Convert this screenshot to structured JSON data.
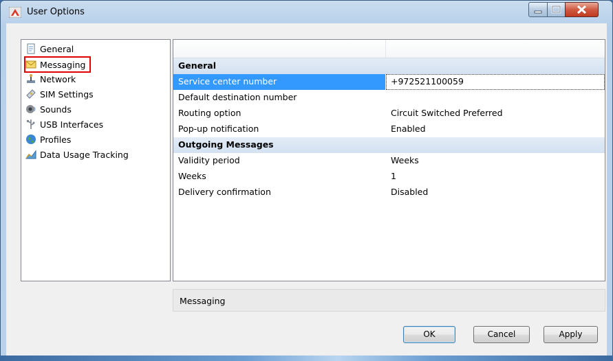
{
  "window": {
    "title": "User Options"
  },
  "nav": {
    "items": [
      {
        "label": "General",
        "icon": "page-icon"
      },
      {
        "label": "Messaging",
        "icon": "envelope-icon",
        "selected": true
      },
      {
        "label": "Network",
        "icon": "network-icon"
      },
      {
        "label": "SIM Settings",
        "icon": "sim-card-icon"
      },
      {
        "label": "Sounds",
        "icon": "speaker-icon"
      },
      {
        "label": "USB Interfaces",
        "icon": "usb-icon"
      },
      {
        "label": "Profiles",
        "icon": "globe-icon"
      },
      {
        "label": "Data Usage Tracking",
        "icon": "chart-icon"
      }
    ]
  },
  "grid": {
    "sections": [
      {
        "title": "General",
        "rows": [
          {
            "key": "Service center number",
            "value": "+972521100059",
            "selected": true
          },
          {
            "key": "Default destination number",
            "value": ""
          },
          {
            "key": "Routing option",
            "value": "Circuit Switched Preferred"
          },
          {
            "key": "Pop-up notification",
            "value": "Enabled"
          }
        ]
      },
      {
        "title": "Outgoing Messages",
        "rows": [
          {
            "key": "Validity period",
            "value": "Weeks"
          },
          {
            "key": "Weeks",
            "value": "1"
          },
          {
            "key": "Delivery confirmation",
            "value": "Disabled"
          }
        ]
      }
    ]
  },
  "status": {
    "text": "Messaging"
  },
  "buttons": {
    "ok": "OK",
    "cancel": "Cancel",
    "apply": "Apply"
  },
  "colors": {
    "selection": "#3399ff",
    "highlight_box": "#e00000",
    "section_band": "#dbe6f4"
  }
}
